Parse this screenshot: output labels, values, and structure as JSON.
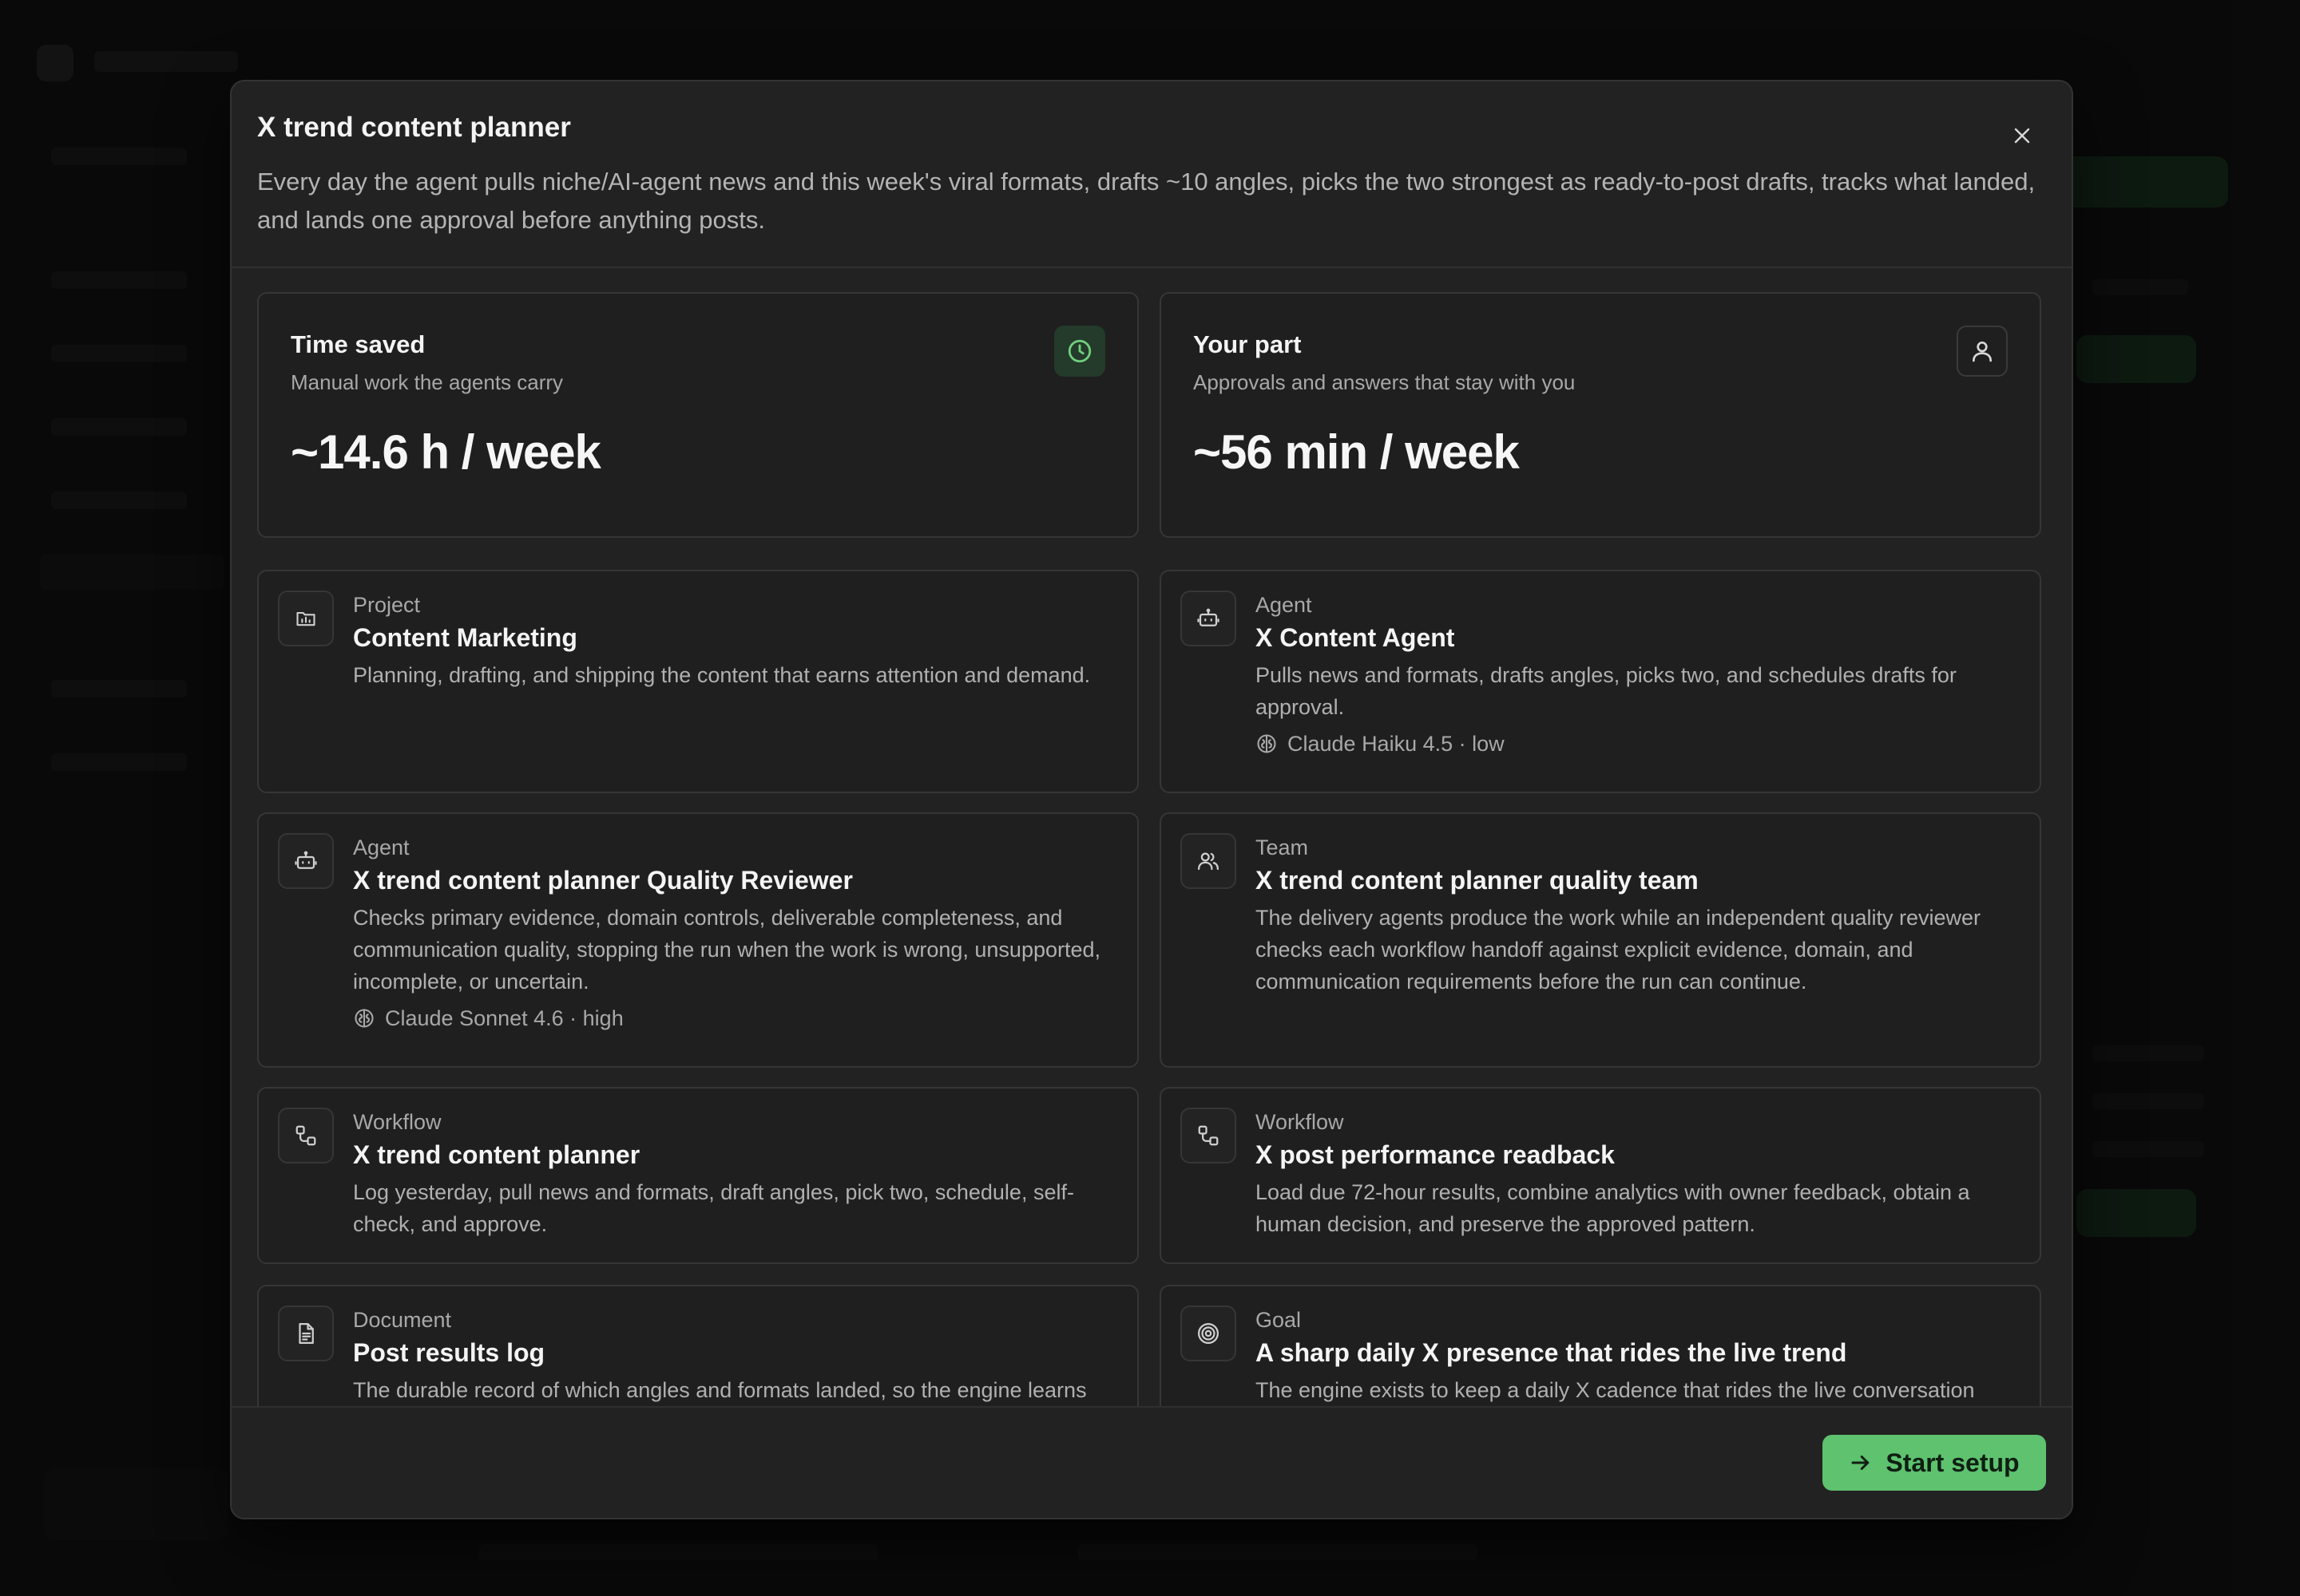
{
  "modal": {
    "title": "X trend content planner",
    "description": "Every day the agent pulls niche/AI-agent news and this week's viral formats, drafts ~10 angles, picks the two strongest as ready-to-post drafts, tracks what landed, and lands one approval before anything posts.",
    "close_icon": "close-icon",
    "start_button_label": "Start setup",
    "start_button_icon": "arrow-right-icon"
  },
  "metrics": [
    {
      "title": "Time saved",
      "subtitle": "Manual work the agents carry",
      "value": "~14.6 h / week",
      "icon": "clock-icon",
      "icon_color": "#6fcf7e"
    },
    {
      "title": "Your part",
      "subtitle": "Approvals and answers that stay with you",
      "value": "~56 min / week",
      "icon": "user-icon",
      "icon_color": "#d8d8d8"
    }
  ],
  "items": [
    {
      "type": "Project",
      "title": "Content Marketing",
      "description": "Planning, drafting, and shipping the content that earns attention and demand.",
      "icon": "folder-chart-icon"
    },
    {
      "type": "Agent",
      "title": "X Content Agent",
      "description": "Pulls news and formats, drafts angles, picks two, and schedules drafts for approval.",
      "model": "Claude Haiku 4.5 · low",
      "icon": "bot-icon"
    },
    {
      "type": "Agent",
      "title": "X trend content planner Quality Reviewer",
      "description": "Checks primary evidence, domain controls, deliverable completeness, and communication quality, stopping the run when the work is wrong, unsupported, incomplete, or uncertain.",
      "model": "Claude Sonnet 4.6 · high",
      "icon": "bot-icon"
    },
    {
      "type": "Team",
      "title": "X trend content planner quality team",
      "description": "The delivery agents produce the work while an independent quality reviewer checks each workflow handoff against explicit evidence, domain, and communication requirements before the run can continue.",
      "icon": "users-icon"
    },
    {
      "type": "Workflow",
      "title": "X trend content planner",
      "description": "Log yesterday, pull news and formats, draft angles, pick two, schedule, self-check, and approve.",
      "icon": "workflow-icon"
    },
    {
      "type": "Workflow",
      "title": "X post performance readback",
      "description": "Load due 72-hour results, combine analytics with owner feedback, obtain a human decision, and preserve the approved pattern.",
      "icon": "workflow-icon"
    },
    {
      "type": "Document",
      "title": "Post results log",
      "description": "The durable record of which angles and formats landed, so the engine learns",
      "icon": "document-icon"
    },
    {
      "type": "Goal",
      "title": "A sharp daily X presence that rides the live trend",
      "description": "The engine exists to keep a daily X cadence that rides the live conversation",
      "icon": "target-icon"
    }
  ],
  "colors": {
    "accent": "#5ec26f",
    "modal_bg": "#222222",
    "card_bg": "#1f1f1f"
  }
}
